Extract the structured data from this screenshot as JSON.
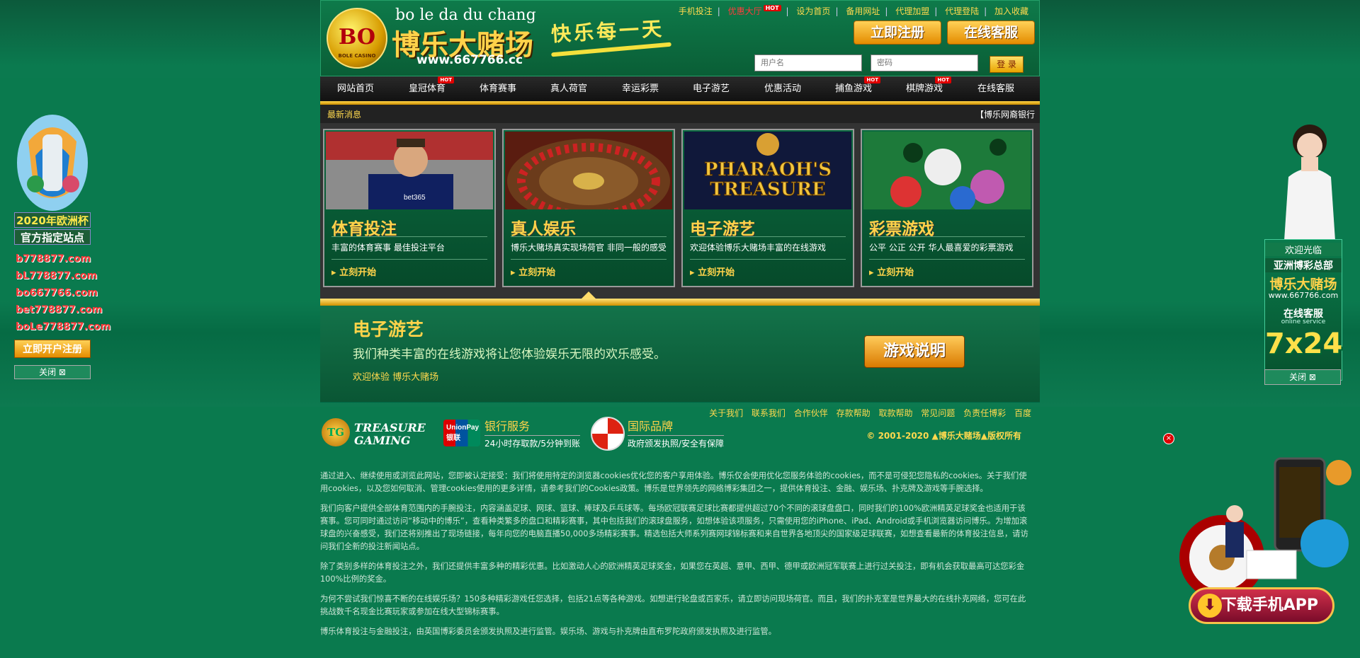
{
  "header": {
    "logo_badge": "BO",
    "logo_badge_sub": "BOLE CASINO",
    "logo_pinyin": "bo le da du chang",
    "logo_cn": "博乐大赌场",
    "logo_url": "www.667766.cc",
    "slogan": "快乐每一天",
    "top_links": [
      "手机投注",
      "优惠大厅",
      "设为首页",
      "备用网址",
      "代理加盟",
      "代理登陆",
      "加入收藏"
    ],
    "hot_badge": "HOT",
    "register_button": "立即注册",
    "service_button": "在线客服",
    "username_placeholder": "用户名",
    "password_placeholder": "密码",
    "login_button": "登 录"
  },
  "nav": {
    "items": [
      "网站首页",
      "皇冠体育",
      "体育赛事",
      "真人荷官",
      "幸运彩票",
      "电子游艺",
      "优惠活动",
      "捕鱼游戏",
      "棋牌游戏",
      "在线客服"
    ],
    "hot_badge": "HOT"
  },
  "news": {
    "label": "最新消息",
    "text": "【博乐网裔银行"
  },
  "cards": [
    {
      "title": "体育投注",
      "desc": "丰富的体育赛事 最佳投注平台",
      "cta": "立刻开始"
    },
    {
      "title": "真人娱乐",
      "desc": "博乐大赌场真实现场荷官 非同一般的感受",
      "cta": "立刻开始"
    },
    {
      "title": "电子游艺",
      "desc": "欢迎体验博乐大赌场丰富的在线游戏",
      "cta": "立刻开始",
      "image_text_1": "PHARAOH'S",
      "image_text_2": "TREASURE"
    },
    {
      "title": "彩票游戏",
      "desc": "公平 公正 公开 华人最喜爱的彩票游戏",
      "cta": "立刻开始"
    }
  ],
  "intro": {
    "title": "电子游艺",
    "desc": "我们种类丰富的在线游戏将让您体验娱乐无限的欢乐感受。",
    "welcome": "欢迎体验 博乐大赌场",
    "button": "游戏说明"
  },
  "footer": {
    "tg_mark": "TG",
    "tg_name_1": "TREASURE",
    "tg_name_2": "GAMING",
    "bank_logo": "UnionPay 银联",
    "bank_title": "银行服务",
    "bank_sub": "24小时存取款/5分钟到账",
    "brand_title": "国际品牌",
    "brand_sub": "政府颁发执照/安全有保障",
    "links": [
      "关于我们",
      "联系我们",
      "合作伙伴",
      "存款帮助",
      "取款帮助",
      "常见问题",
      "负责任博彩",
      "百度"
    ],
    "copyright": "© 2001-2020 ▲博乐大赌场▲版权所有"
  },
  "legal": [
    "通过进入、继续使用或浏览此网站，您即被认定接受：我们将使用特定的浏览器cookies优化您的客户享用体验。博乐仅会使用优化您服务体验的cookies，而不是可侵犯您隐私的cookies。关于我们使用cookies，以及您如何取消、管理cookies使用的更多详情，请参考我们的Cookies政策。博乐是世界领先的网络博彩集团之一，提供体育投注、金融、娱乐场、扑克牌及游戏等手腕选择。",
    "我们向客户提供全部体育范围内的手腕投注，内容涵盖足球、网球、篮球、棒球及乒乓球等。每场欧冠联赛足球比赛都提供超过70个不同的滚球盘盘口，同时我们的100%欧洲精英足球奖金也适用于该赛事。您可同时通过访问“移动中的博乐”，查看种类繁多的盘口和精彩赛事，其中包括我们的滚球盘服务，如想体验该项服务，只需使用您的iPhone、iPad、Android或手机浏览器访问博乐。为增加滚球盘的兴奋感受，我们还将别推出了现场链接，每年向您的电脑直播50,000多场精彩赛事。精选包括大师系列赛网球锦标赛和来自世界各地顶尖的国家级足球联赛，如想查看最新的体育投注信息，请访问我们全新的投注新闻站点。",
    "除了类别多样的体育投注之外，我们还提供丰富多种的精彩优惠。比如激动人心的欧洲精英足球奖金，如果您在英超、意甲、西甲、德甲或欧洲冠军联赛上进行过关投注，即有机会获取最高可达您彩金100%比例的奖金。",
    "为何不尝试我们惊喜不断的在线娱乐场？150多种精彩游戏任您选择，包括21点等各种游戏。如想进行轮盘或百家乐，请立即访问现场荷官。而且，我们的扑克室是世界最大的在线扑克网络，您可在此挑战数千名现金比赛玩家或参加在线大型锦标赛事。",
    "博乐体育投注与金融投注，由英国博彩委员会颁发执照及进行监管。娱乐场、游戏与扑克牌由直布罗陀政府颁发执照及进行监管。"
  ],
  "left_float": {
    "line1": "2020年欧洲杯",
    "line2": "官方指定站点",
    "urls": [
      "b778877.com",
      "bL778877.com",
      "bo667766.com",
      "bet778877.com",
      "boLe778877.com"
    ],
    "register": "立即开户注册",
    "close": "关闭 ⊠"
  },
  "right_float": {
    "welcome": "欢迎光临",
    "line2": "亚洲博彩总部",
    "brand": "博乐大赌场",
    "url": "www.667766.com",
    "service": "在线客服",
    "service_en": "online service",
    "hours": "7x24",
    "close": "关闭 ⊠"
  },
  "app_ad": {
    "close": "×",
    "button": "下载手机APP"
  }
}
